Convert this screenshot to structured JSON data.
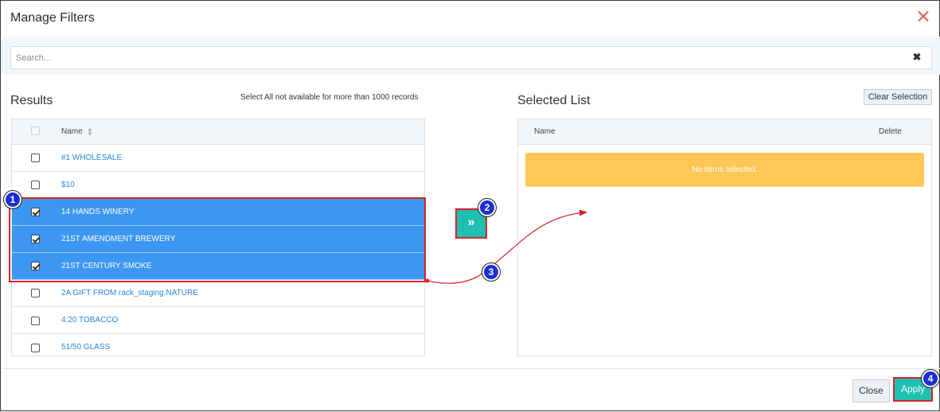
{
  "dialog": {
    "title": "Manage Filters",
    "close_icon": "close-icon"
  },
  "search": {
    "placeholder": "Search...",
    "value": "",
    "clear_icon": "✖"
  },
  "results": {
    "label": "Results",
    "note": "Select All not available for more than 1000 records",
    "column_name": "Name",
    "sort_icon": "⇕",
    "rows": [
      {
        "name": "#1 WHOLESALE",
        "checked": false,
        "selected": false
      },
      {
        "name": "$10",
        "checked": false,
        "selected": false
      },
      {
        "name": "14 HANDS WINERY",
        "checked": true,
        "selected": true
      },
      {
        "name": "21ST AMENDMENT BREWERY",
        "checked": true,
        "selected": true
      },
      {
        "name": "21ST CENTURY SMOKE",
        "checked": true,
        "selected": true
      },
      {
        "name": "2A GIFT FROM rack_staging.NATURE",
        "checked": false,
        "selected": false
      },
      {
        "name": "4:20 TOBACCO",
        "checked": false,
        "selected": false
      },
      {
        "name": "51/50 GLASS",
        "checked": false,
        "selected": false
      }
    ]
  },
  "move_button": {
    "label": "»"
  },
  "selected": {
    "label": "Selected List",
    "clear_button": "Clear Selection",
    "column_name": "Name",
    "column_delete": "Delete",
    "empty_message": "No items selected."
  },
  "footer": {
    "close_label": "Close",
    "apply_label": "Apply"
  },
  "annotations": {
    "step1": "1",
    "step2": "2",
    "step3": "3",
    "step4": "4",
    "color": "#d8232a",
    "badge_color": "#1a2fd6"
  }
}
